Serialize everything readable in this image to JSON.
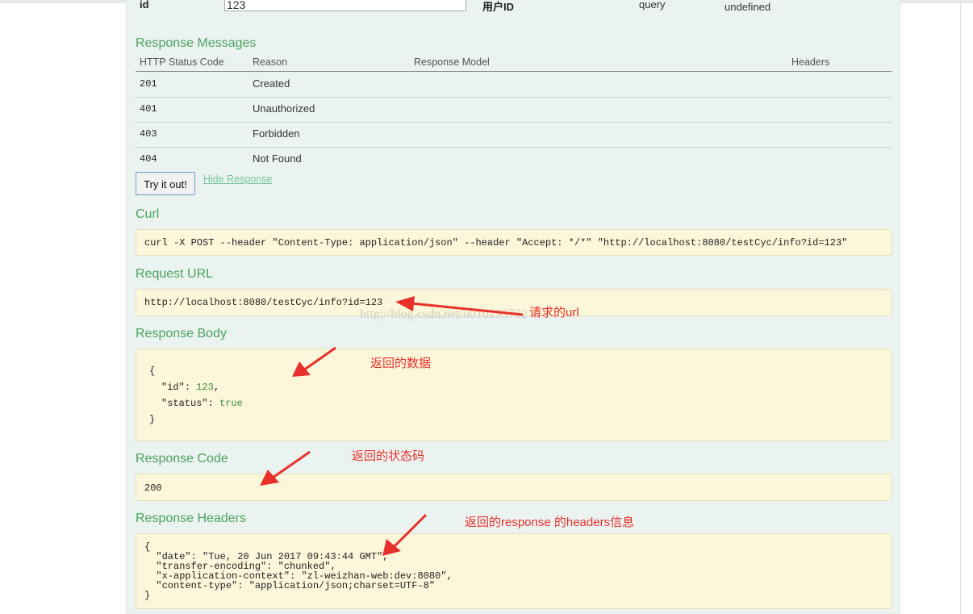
{
  "param_row": {
    "name": "id",
    "value": "123",
    "description": "用户ID",
    "param_type": "query",
    "data_type": "undefined"
  },
  "response_messages": {
    "title": "Response Messages",
    "headers": [
      "HTTP Status Code",
      "Reason",
      "Response Model",
      "Headers"
    ],
    "rows": [
      {
        "code": "201",
        "reason": "Created"
      },
      {
        "code": "401",
        "reason": "Unauthorized"
      },
      {
        "code": "403",
        "reason": "Forbidden"
      },
      {
        "code": "404",
        "reason": "Not Found"
      }
    ]
  },
  "actions": {
    "try_label": "Try it out!",
    "hide_label": "Hide Response"
  },
  "curl": {
    "title": "Curl",
    "command": "curl -X POST --header \"Content-Type: application/json\" --header \"Accept: */*\" \"http://localhost:8080/testCyc/info?id=123\""
  },
  "request_url": {
    "title": "Request URL",
    "value": "http://localhost:8080/testCyc/info?id=123"
  },
  "response_body": {
    "title": "Response Body",
    "open": "{",
    "id_key": "\"id\"",
    "id_value": "123",
    "status_key": "\"status\"",
    "status_value": "true",
    "close": "}"
  },
  "response_code": {
    "title": "Response Code",
    "value": "200"
  },
  "response_headers": {
    "title": "Response Headers",
    "lines": [
      "{",
      "  \"date\": \"Tue, 20 Jun 2017 09:43:44 GMT\",",
      "  \"transfer-encoding\": \"chunked\",",
      "  \"x-application-context\": \"zl-weizhan-web:dev:8080\",",
      "  \"content-type\": \"application/json;charset=UTF-8\"",
      "}"
    ]
  },
  "annotations": {
    "url_note": "请求的url",
    "body_note": "返回的数据",
    "code_note": "返回的状态码",
    "headers_note": "返回的response 的headers信息"
  },
  "watermark": "http://blog.csdn.net/u010295732",
  "colors": {
    "section_title": "#4aa35d",
    "panel_bg": "#ebf3f0",
    "code_block_bg": "#fcf6db",
    "annotation": "#e8302a"
  }
}
